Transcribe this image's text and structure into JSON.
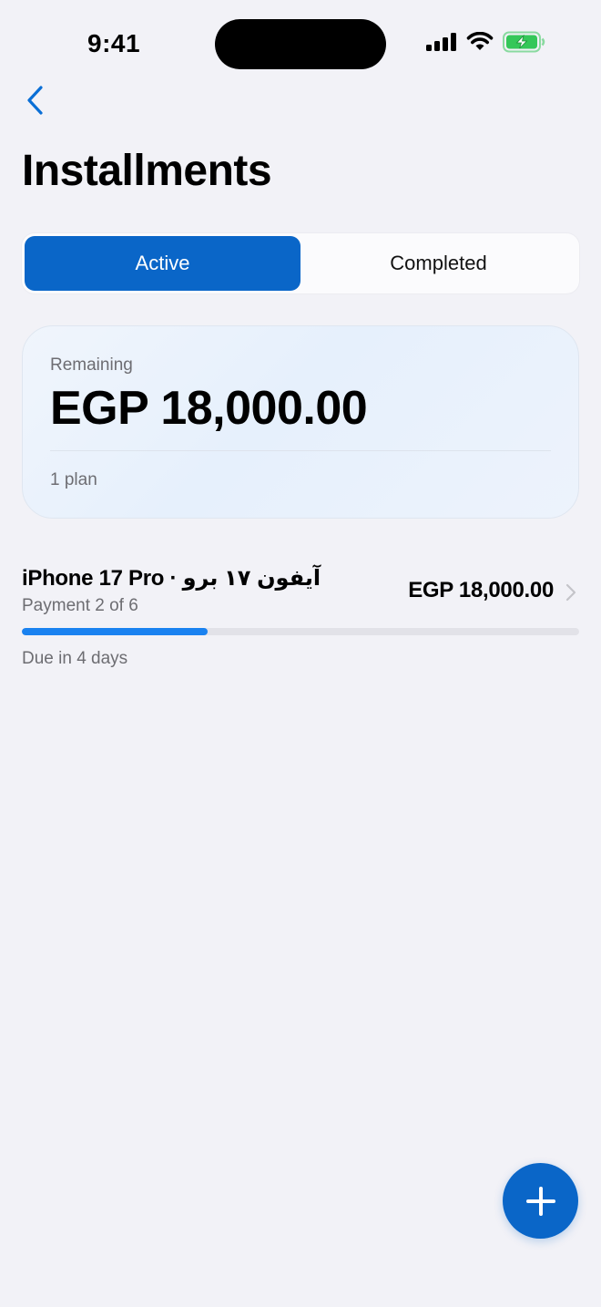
{
  "status_bar": {
    "time": "9:41",
    "icons": [
      "cellular-signal-icon",
      "wifi-icon",
      "battery-charging-icon"
    ]
  },
  "nav": {
    "back_icon": "chevron-left-icon",
    "title": "Installments"
  },
  "tabs": [
    {
      "label": "Active",
      "selected": true
    },
    {
      "label": "Completed",
      "selected": false
    }
  ],
  "summary": {
    "label": "Remaining",
    "amount": "EGP 18,000.00",
    "plans_count": "1 plan"
  },
  "plans": [
    {
      "name": "iPhone 17 Pro · آيفون ١٧ برو",
      "payment_status": "Payment 2 of 6",
      "amount": "EGP 18,000.00",
      "progress_fraction": 0.333,
      "due": "Due in 4 days"
    }
  ],
  "fab": {
    "icon": "plus-icon"
  },
  "colors": {
    "accent": "#0a66c8",
    "progress": "#1a82f0",
    "background": "#f2f2f7"
  }
}
